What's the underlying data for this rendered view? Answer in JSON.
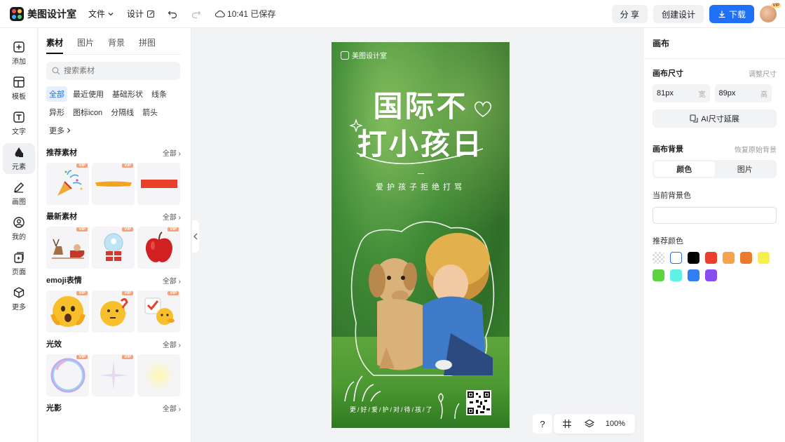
{
  "app": {
    "name": "美图设计室"
  },
  "topbar": {
    "file_menu": "文件",
    "design_menu": "设计",
    "save_status": "10:41 已保存",
    "share_label": "分 享",
    "create_label": "创建设计",
    "download_label": "下载",
    "avatar_badge": "VIP"
  },
  "rail": [
    {
      "label": "添加",
      "icon": "plus-icon"
    },
    {
      "label": "模板",
      "icon": "template-icon"
    },
    {
      "label": "文字",
      "icon": "text-icon"
    },
    {
      "label": "元素",
      "icon": "element-icon"
    },
    {
      "label": "画图",
      "icon": "draw-icon"
    },
    {
      "label": "我的",
      "icon": "user-icon"
    },
    {
      "label": "页面",
      "icon": "page-icon"
    },
    {
      "label": "更多",
      "icon": "more-icon"
    }
  ],
  "panel": {
    "tabs": [
      "素材",
      "图片",
      "背景",
      "拼图"
    ],
    "search_placeholder": "搜索素材",
    "chips": [
      "全部",
      "最近使用",
      "基础形状",
      "线条",
      "异形",
      "图标icon",
      "分隔线",
      "箭头",
      "更多"
    ],
    "see_all": "全部",
    "vip": "VIP",
    "sections": [
      "推荐素材",
      "最新素材",
      "emoji表情",
      "光效",
      "光影"
    ]
  },
  "poster": {
    "brand": "美图设计室",
    "title_line1": "国际不",
    "title_line2": "打小孩日",
    "subtitle": "爱护孩子拒绝打骂",
    "footer": "更/好/爱/护/对/待/孩/了"
  },
  "canvas_tools": {
    "help": "?",
    "zoom": "100%"
  },
  "right_panel": {
    "title": "画布",
    "size_label": "画布尺寸",
    "resize_link": "调整尺寸",
    "width_value": "81px",
    "width_unit": "宽",
    "height_value": "89px",
    "height_unit": "高",
    "ai_extend": "AI尺寸延展",
    "bg_label": "画布背景",
    "restore_bg": "恢复原始背景",
    "seg_color": "颜色",
    "seg_image": "图片",
    "current_bg": "当前背景色",
    "recommended": "推荐颜色",
    "swatches": [
      "transparent",
      "#ffffff",
      "#000000",
      "#e8402a",
      "#f2a54a",
      "#ec7a2c",
      "#f8f04a",
      "#5bd43f",
      "#5ff0e6",
      "#2f7ef2",
      "#8a4ef0"
    ]
  }
}
